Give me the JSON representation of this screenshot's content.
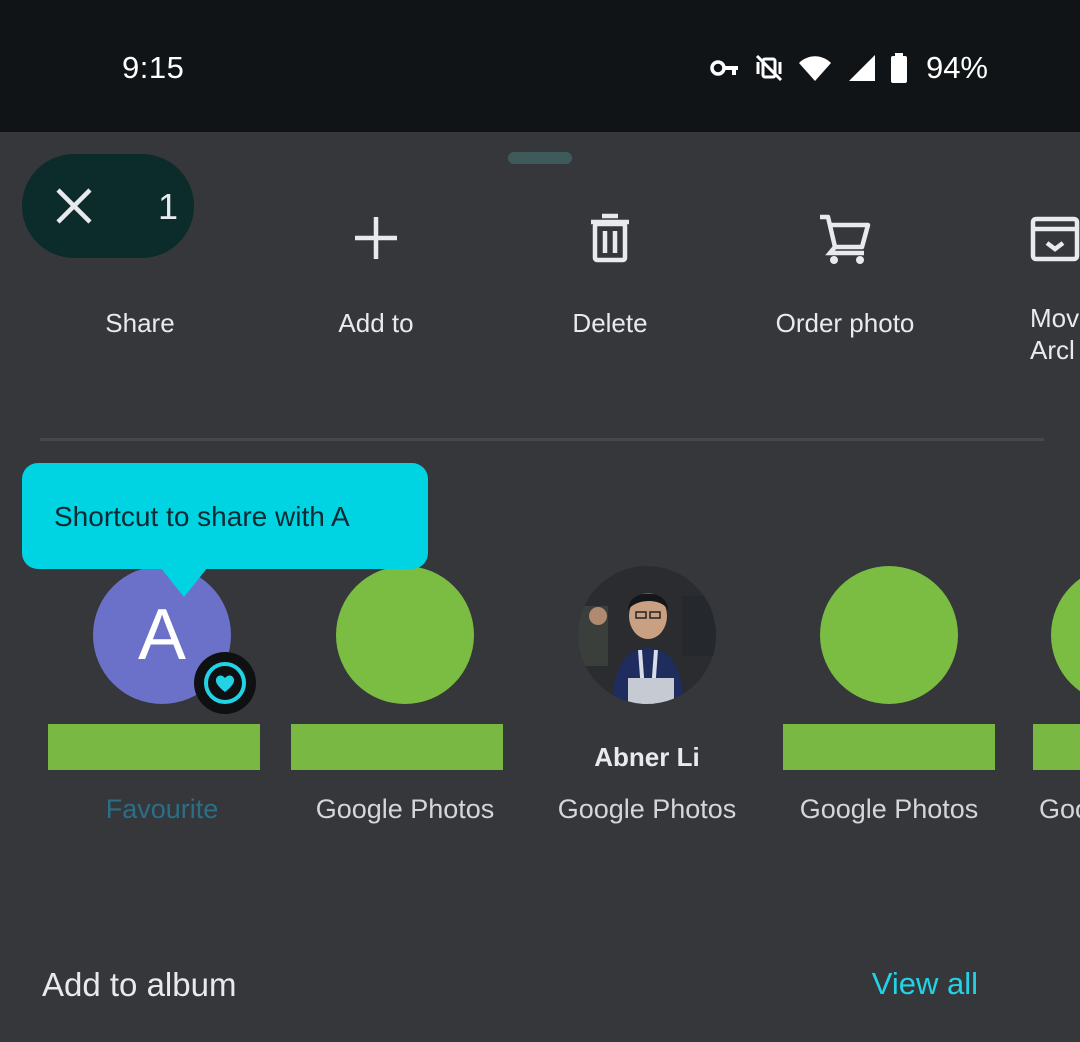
{
  "status_bar": {
    "time": "9:15",
    "battery": "94%",
    "icons": [
      "vpn-key-icon",
      "vibrate-off-icon",
      "wifi-icon",
      "signal-icon",
      "battery-icon"
    ]
  },
  "selection": {
    "count": "1"
  },
  "actions": [
    {
      "id": "share",
      "label": "Share",
      "icon": "share-icon"
    },
    {
      "id": "add-to",
      "label": "Add to",
      "icon": "plus-icon"
    },
    {
      "id": "delete",
      "label": "Delete",
      "icon": "trash-icon"
    },
    {
      "id": "order-photo",
      "label": "Order photo",
      "icon": "cart-icon"
    },
    {
      "id": "move-archive",
      "label": "Mov\nArcl",
      "icon": "archive-icon"
    }
  ],
  "tooltip": {
    "text": "Shortcut to share with A"
  },
  "contacts": [
    {
      "initial": "A",
      "sublabel": "Favourite",
      "avatar_color": "#6b71c9"
    },
    {
      "sublabel": "Google Photos",
      "avatar_color": "#7bbd42"
    },
    {
      "name": "Abner Li",
      "sublabel": "Google Photos"
    },
    {
      "sublabel": "Google Photos",
      "avatar_color": "#7bbd42"
    },
    {
      "sublabel": "Goo",
      "avatar_color": "#7bbd42"
    }
  ],
  "album_section": {
    "title": "Add to album",
    "view_all": "View all"
  },
  "colors": {
    "accent": "#22d3e6",
    "tooltip_bg": "#00d4e3",
    "redaction": "#78b843"
  }
}
